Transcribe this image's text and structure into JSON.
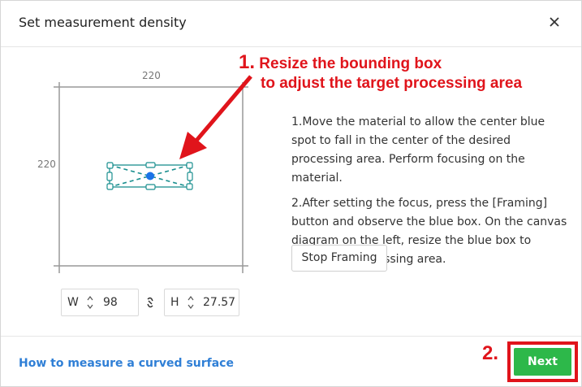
{
  "dialog": {
    "title": "Set measurement density"
  },
  "canvas": {
    "width_label": "220",
    "height_label": "220"
  },
  "annotation_1": {
    "number": "1.",
    "line1": "Resize the bounding box",
    "line2": "to adjust the target processing area"
  },
  "instructions": {
    "step1": "1.Move the material to allow the center blue spot to fall in the center of the desired processing area. Perform focusing on the material.",
    "step2": "2.After setting the focus, press the [Framing] button and observe the blue box. On the canvas diagram on the left, resize the blue box to adjust the processing area."
  },
  "buttons": {
    "stop_framing": "Stop Framing",
    "next": "Next"
  },
  "size": {
    "w_label": "W",
    "w_value": "98",
    "h_label": "H",
    "h_value": "27.57"
  },
  "footer": {
    "link": "How to measure a curved surface"
  },
  "annotation_2": {
    "number": "2."
  },
  "colors": {
    "accent_red": "#e0141b",
    "next_green": "#2db84a",
    "box_teal": "#1a8f8f",
    "center_blue": "#1a73e8",
    "link_blue": "#2f7fd6"
  },
  "icons": {
    "close": "close-icon",
    "lock": "link-lock-icon",
    "spinner": "spinner-arrows-icon"
  }
}
